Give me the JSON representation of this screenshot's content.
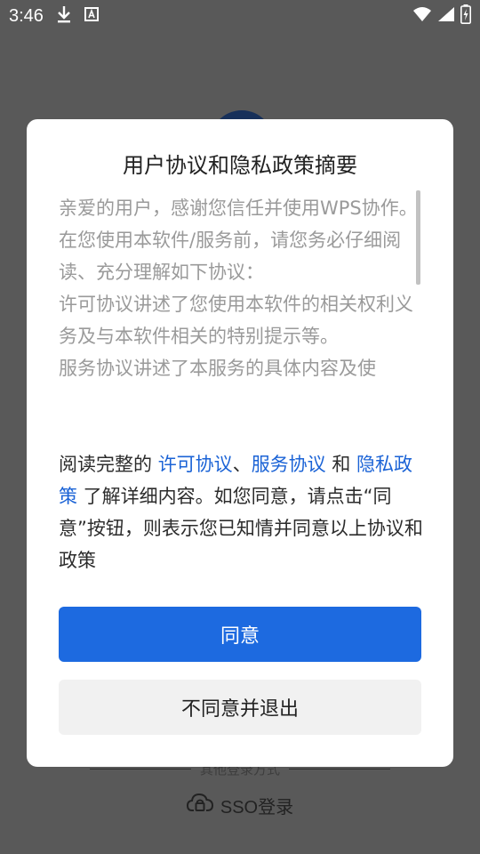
{
  "status_bar": {
    "time": "3:46",
    "icons": [
      "download-icon",
      "text-icon",
      "wifi-icon",
      "signal-icon",
      "battery-charging-icon"
    ]
  },
  "background": {
    "other_login_label": "其他登录方式",
    "sso_label": "SSO登录"
  },
  "dialog": {
    "title": "用户协议和隐私政策摘要",
    "summary": "亲爱的用户，感谢您信任并使用WPS协作。\n在您使用本软件/服务前，请您务必仔细阅读、充分理解如下协议：\n许可协议讲述了您使用本软件的相关权利义务及与本软件相关的特别提示等。\n服务协议讲述了本服务的具体内容及使",
    "notice": {
      "prefix": "阅读完整的 ",
      "link_license": "许可协议",
      "sep1": "、",
      "link_service": "服务协议",
      "and": " 和 ",
      "link_privacy": "隐私政策",
      "suffix": " 了解详细内容。如您同意，请点击“同意”按钮，则表示您已知情并同意以上协议和政策"
    },
    "agree_label": "同意",
    "disagree_label": "不同意并退出"
  },
  "colors": {
    "accent": "#1d6ae0",
    "link": "#1b63d6",
    "overlay": "#595959"
  }
}
